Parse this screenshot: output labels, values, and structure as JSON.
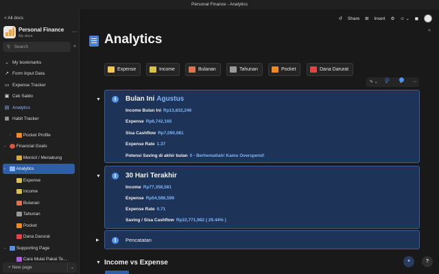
{
  "window": {
    "title": "Personal Finance - Analytics"
  },
  "sidebar": {
    "back_label": "< All docs",
    "workspace": {
      "name": "Personal Finance",
      "subtitle": "My docs",
      "more": "···"
    },
    "search_placeholder": "Search",
    "collapse_icon": "«",
    "items": [
      {
        "label": "My bookmarks",
        "icon": "⌄",
        "icon_name": "chevron-down-icon"
      },
      {
        "label": "Form Input Data",
        "icon": "↗",
        "icon_name": "graph-icon"
      },
      {
        "label": "Expense Tracker",
        "icon": "▭",
        "icon_name": "wallet-icon"
      },
      {
        "label": "Cek Saldo",
        "icon": "▣",
        "icon_name": "card-icon"
      },
      {
        "label": "Analytics",
        "icon": "▤",
        "icon_name": "document-icon"
      },
      {
        "label": "Habit Tracker",
        "icon": "▦",
        "icon_name": "calendar-icon"
      }
    ],
    "tree": [
      {
        "label": "Pocket Profile",
        "color": "#f08a24",
        "chevron": "›"
      },
      {
        "label": "Financial Goals",
        "color": "#e5533d",
        "chevron": "⌄"
      },
      {
        "label": "Menicil / Menabung",
        "color": "#d8a83b",
        "chevron": ""
      },
      {
        "label": "Analytics",
        "color": "#5b8fe0",
        "chevron": "⌄"
      },
      {
        "label": "Expense",
        "color": "#d9c24a",
        "chevron": ""
      },
      {
        "label": "Income",
        "color": "#d9c24a",
        "chevron": ""
      },
      {
        "label": "Bulanan",
        "color": "#e0724f",
        "chevron": ""
      },
      {
        "label": "Tahunan",
        "color": "#9a9a9a",
        "chevron": ""
      },
      {
        "label": "Pocket",
        "color": "#f08a24",
        "chevron": ""
      },
      {
        "label": "Dana Darurat",
        "color": "#e04545",
        "chevron": ""
      },
      {
        "label": "Supporting Page",
        "color": "#5b8fe0",
        "chevron": "⌄"
      },
      {
        "label": "Cara Mulai Pakai Te...",
        "color": "#b35be0",
        "chevron": ""
      }
    ],
    "new_page_label": "+ New page",
    "new_page_caret": "⌄"
  },
  "topbar": {
    "share": "Share",
    "insert": "Insert"
  },
  "page": {
    "title": "Analytics"
  },
  "tabs": [
    {
      "label": "Expense",
      "color": "#f2c94c"
    },
    {
      "label": "Income",
      "color": "#d9c24a"
    },
    {
      "label": "Bulanan",
      "color": "#e0724f"
    },
    {
      "label": "Tahunan",
      "color": "#9a9a9a"
    },
    {
      "label": "Pocket",
      "color": "#f08a24"
    },
    {
      "label": "Dana Darurat",
      "color": "#e04545"
    }
  ],
  "callout_monthly": {
    "title": "Bulan Ini",
    "month": "Agustus",
    "rows": [
      {
        "label": "Income Bulan Ini",
        "value": "Rp13,832,246"
      },
      {
        "label": "Expense",
        "value": "Rp6,742,165"
      },
      {
        "label": "Sisa Cashflow",
        "value": "Rp7,090,081"
      },
      {
        "label": "Expense Rate",
        "value": "1.37"
      },
      {
        "label": "Potensi Saving di akhir bulan",
        "value": "0 - Berhematlah! Kamu Overspend!"
      }
    ]
  },
  "callout_30days": {
    "title": "30 Hari Terakhir",
    "rows": [
      {
        "label": "Income",
        "value": "Rp77,358,581"
      },
      {
        "label": "Expense",
        "value": "Rp54,586,599"
      },
      {
        "label": "Expense Rate",
        "value": "0.71"
      },
      {
        "label": "Saving / Sisa Cashflow",
        "value": "Rp22,771,982  ( 29.44% )"
      }
    ]
  },
  "callout_pencatatan": {
    "title": "Pencatatan"
  },
  "section": {
    "heading": "Income vs Expense"
  },
  "fab": {
    "help": "?"
  }
}
